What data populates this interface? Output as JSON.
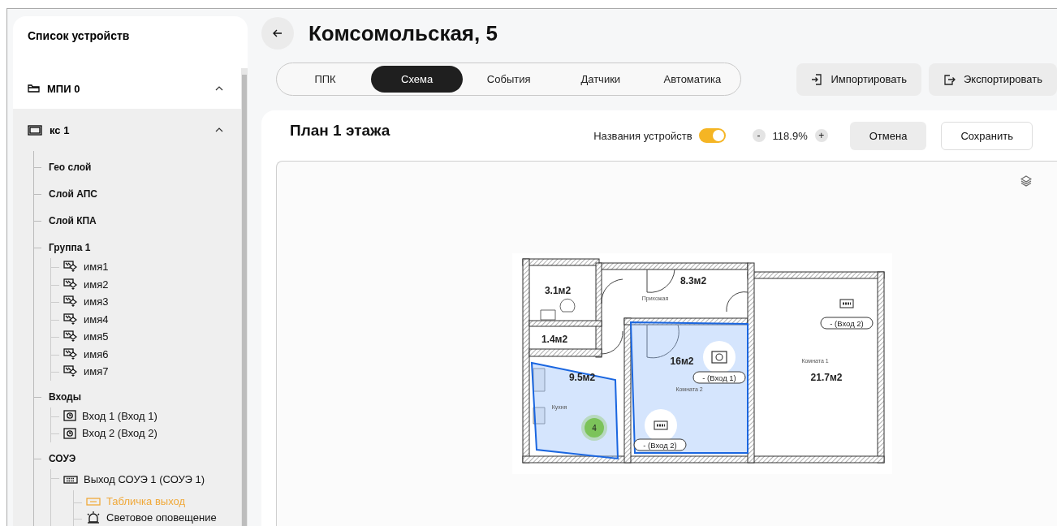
{
  "sidebar": {
    "title": "Список устройств",
    "tree": [
      {
        "label": "МПИ 0",
        "kind": "module",
        "expanded": true,
        "selected": false
      },
      {
        "label": "кс 1",
        "kind": "panel",
        "expanded": true,
        "selected": true,
        "children": [
          {
            "label": "Гео слой",
            "kind": "group",
            "selected": false
          },
          {
            "label": "Слой АПС",
            "kind": "group",
            "selected": false
          },
          {
            "label": "Слой КПА",
            "kind": "group",
            "selected": false
          },
          {
            "label": "Группа 1",
            "kind": "group",
            "selected": false,
            "children": [
              {
                "label": "имя1",
                "kind": "detector",
                "selected": false
              },
              {
                "label": "имя2",
                "kind": "detector",
                "selected": false
              },
              {
                "label": "имя3",
                "kind": "detector",
                "selected": false
              },
              {
                "label": "имя4",
                "kind": "detector",
                "selected": false
              },
              {
                "label": "имя5",
                "kind": "detector",
                "selected": false
              },
              {
                "label": "имя6",
                "kind": "detector",
                "selected": false
              },
              {
                "label": "имя7",
                "kind": "detector",
                "selected": false
              }
            ]
          },
          {
            "label": "Входы",
            "kind": "group",
            "selected": false,
            "children": [
              {
                "label": "Вход 1 (Вход 1)",
                "kind": "input",
                "selected": false
              },
              {
                "label": "Вход 2 (Вход 2)",
                "kind": "input",
                "selected": false
              }
            ]
          },
          {
            "label": "СОУЭ",
            "kind": "group",
            "selected": false,
            "children": [
              {
                "label": "Выход СОУЭ 1 (СОУЭ 1)",
                "kind": "output",
                "selected": false,
                "children": [
                  {
                    "label": "Табличка выход",
                    "kind": "sign",
                    "selected": true
                  },
                  {
                    "label": "Световое оповещение",
                    "kind": "beacon",
                    "selected": false
                  }
                ]
              }
            ]
          }
        ]
      }
    ]
  },
  "header": {
    "title": "Комсомольская, 5",
    "tabs": [
      {
        "label": "ППК",
        "selected": false
      },
      {
        "label": "Схема",
        "selected": true
      },
      {
        "label": "События",
        "selected": false
      },
      {
        "label": "Датчики",
        "selected": false
      },
      {
        "label": "Автоматика",
        "selected": false
      }
    ],
    "actions": [
      {
        "label": "Импортировать",
        "kind": "import"
      },
      {
        "label": "Экспортировать",
        "kind": "export"
      }
    ]
  },
  "plan": {
    "title": "План 1 этажа",
    "device_names": {
      "label": "Названия устройств",
      "on": true
    },
    "zoom": {
      "decrease": "-",
      "value": "118.9%",
      "increase": "+"
    },
    "buttons": [
      {
        "label": "Отмена",
        "kind": "secondary"
      },
      {
        "label": "Сохранить",
        "kind": "outline"
      }
    ],
    "floor_plan": {
      "rooms": [
        {
          "area": "3.1м2"
        },
        {
          "area": "1.4м2"
        },
        {
          "area": "9.5м2",
          "name": "Кухня"
        },
        {
          "area": "8.3м2",
          "name": "Прихожая"
        },
        {
          "area": "16м2",
          "name": "Комната 2"
        },
        {
          "area": "21.7м2",
          "name": "Комната 1"
        }
      ],
      "markers": [
        {
          "kind": "input",
          "label": "- (Вход 1)"
        },
        {
          "kind": "output",
          "label": "- (Вход 2)"
        },
        {
          "kind": "output",
          "label": "- (Вход 2)"
        }
      ],
      "cluster": {
        "count": "4"
      }
    }
  }
}
